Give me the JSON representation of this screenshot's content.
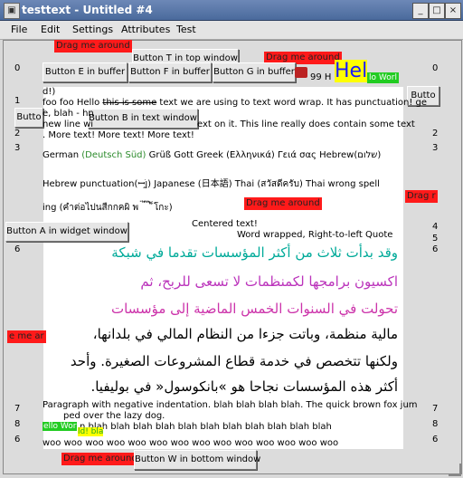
{
  "window": {
    "title": "testtext - Untitled #4",
    "close": "×",
    "min": "_",
    "max": "□"
  },
  "menu": [
    "File",
    "Edit",
    "Settings",
    "Attributes",
    "Test"
  ],
  "line_numbers": [
    "0",
    "1",
    "2",
    "3",
    "4",
    "5",
    "6",
    "7",
    "8",
    "6"
  ],
  "line_numbers_left": [
    "0",
    "1",
    "2",
    "3",
    "4",
    "5",
    "6",
    "7",
    "8",
    "6"
  ],
  "buttons": {
    "t_top": "Button T in top window",
    "e_buf": "Button E in buffer",
    "f_buf": "Button F in buffer",
    "g_buf": "Button G in buffer",
    "butto_left": "Butto",
    "b_text": "Button B in text window",
    "a_widget": "Button A in widget window",
    "w_bottom": "Button W in bottom window",
    "butto_right": "Butto"
  },
  "drag": "Drag me around",
  "drag_short": "Drag r",
  "drag_left": "e me ar",
  "text": {
    "top_strip": "99 H",
    "hello_big": "Hel",
    "hello_world": "lo Worl",
    "l1": "d!)",
    "l2a": "foo foo Hello ",
    "l2strike": "this is some",
    "l2b": " text we are using to text word wrap. It has punctuation! ge",
    "l3": "e, blah - hn",
    "l3b": " new line wi",
    "l3c": "ext on it. This line really does contain some text",
    "l4": ". More text! More text! More text!",
    "german_a": "German ",
    "german_b": "(Deutsch Süd)",
    "german_c": " Grüß Gott Greek (Ελληνικά) Γειά σας Hebrew(שלום)",
    "hebrew_p": "Hebrew punctuation(ꟷ֣ןׁ֣) Japanese (日本語) Thai (สวัสดีครับ) Thai wrong spell",
    "thai2": "ing (คำต่อไปนสืกกคผิ พ ่ ้ ๊ ๋ ็โกะ)",
    "centered": "Centered text!",
    "rtl_quote": "Word wrapped, Right-to-left Quote",
    "ar1": "وقد بدأت ثلاث من أكثر المؤسسات تقدما في شبكة",
    "ar2": "اكسيون برامجها لكمنظمات لا تسعى للربح، ثم",
    "ar3": "تحولت في السنوات الخمس الماضية إلى مؤسسات",
    "ar4": "مالية منظمة، وباتت جزءا من النظام المالي في بلدانها،",
    "ar5": "ولكنها تتخصص في خدمة قطاع المشروعات الصغيرة. وأحد",
    "ar6": "أكثر هذه المؤسسات نجاحا هو »بانكوسول« في بوليفيا.",
    "neg1": "Paragraph with negative indentation. blah blah blah blah. The quick brown fox jum",
    "neg2": "ped over the lazy dog.",
    "blah1a": "ello Wor",
    "blah1b": "n blah blah blah blah blah blah blah blah blah blah blah",
    "blah2a": "ld! bla",
    "woo": "woo woo woo woo woo woo woo woo woo woo woo woo woo woo"
  },
  "colors": {
    "drag": "#ff1a1a",
    "highlight": "#ffff00",
    "green": "#22cc22",
    "titlebar": "#5675a8"
  }
}
